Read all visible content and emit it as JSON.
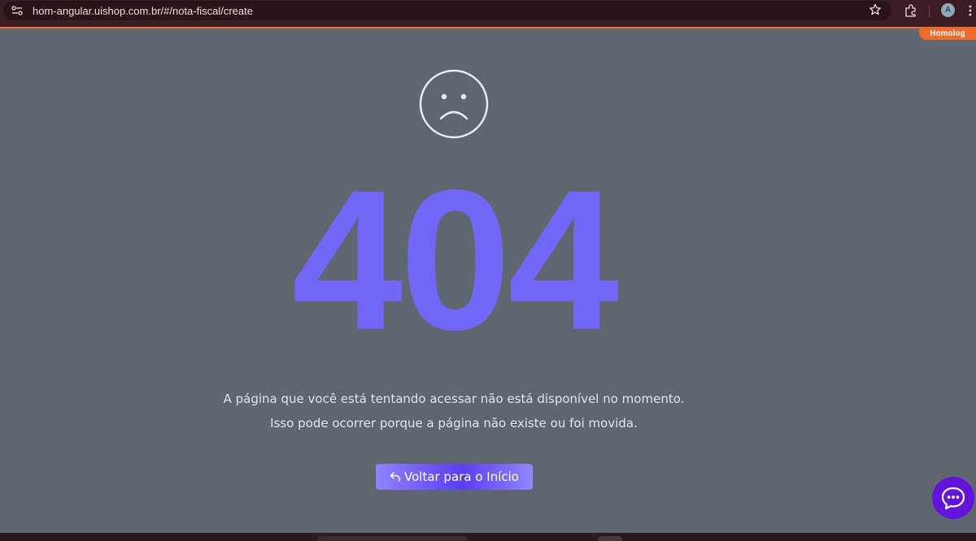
{
  "browser": {
    "url": "hom-angular.uishop.com.br/#/nota-fiscal/create",
    "avatar_initial": "A",
    "environment_badge": "Homolog",
    "accent_color": "#f06a2a"
  },
  "error": {
    "icon": "sad-face-icon",
    "code": "404",
    "message_line1": "A página que você está tentando acessar não está disponível no momento.",
    "message_line2": "Isso pode ocorrer porque a página não existe ou foi movida.",
    "code_color": "#7268f8"
  },
  "actions": {
    "back_label": "Voltar para o Início",
    "back_icon": "undo-arrow-icon"
  },
  "chat": {
    "icon": "chat-bubble-icon",
    "color": "#6413d8"
  }
}
